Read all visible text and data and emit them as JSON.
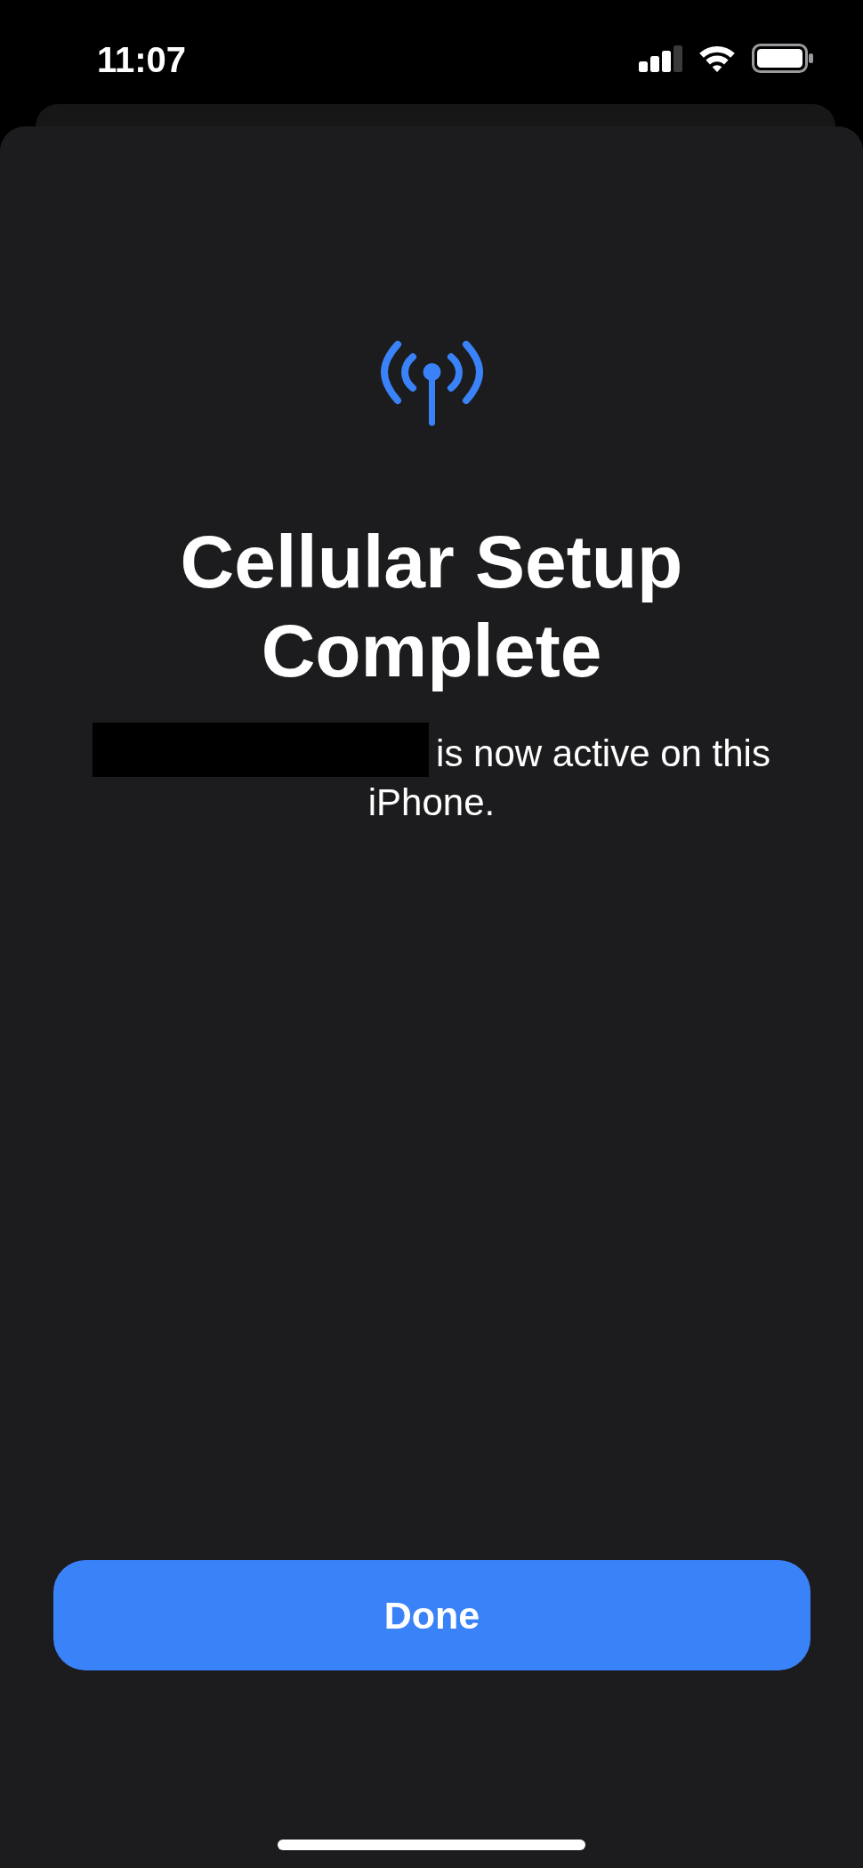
{
  "status_bar": {
    "time": "11:07"
  },
  "sheet": {
    "title": "Cellular Setup Complete",
    "message": {
      "redacted_prefix": true,
      "text": "is now active on this iPhone."
    },
    "primary_button": {
      "label": "Done"
    }
  }
}
